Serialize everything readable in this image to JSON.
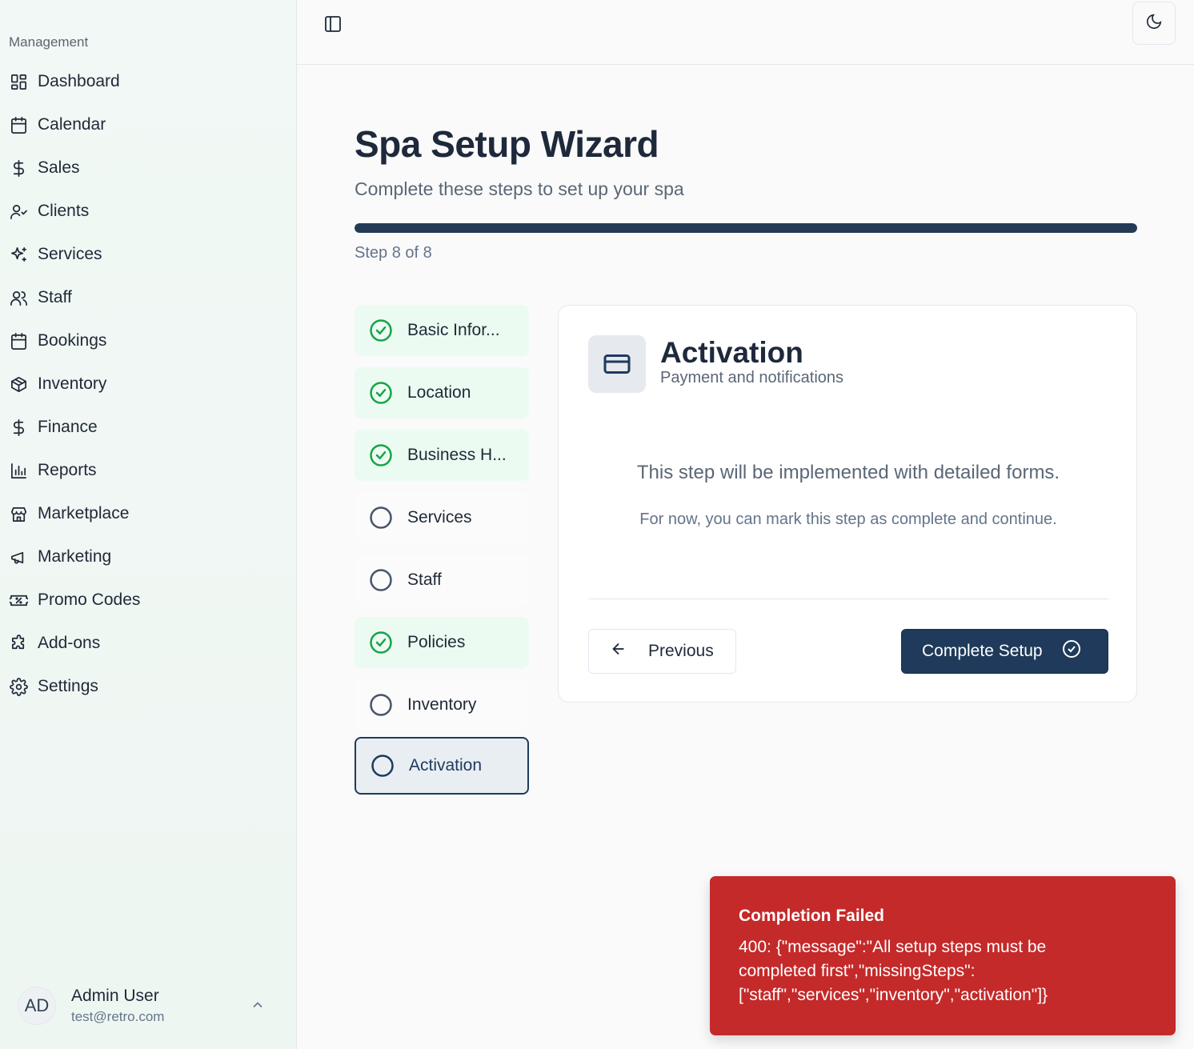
{
  "sidebar": {
    "group_label": "Management",
    "items": [
      {
        "label": "Dashboard",
        "icon": "dashboard-icon"
      },
      {
        "label": "Calendar",
        "icon": "calendar-icon"
      },
      {
        "label": "Sales",
        "icon": "dollar-icon"
      },
      {
        "label": "Clients",
        "icon": "user-check-icon"
      },
      {
        "label": "Services",
        "icon": "sparkles-icon"
      },
      {
        "label": "Staff",
        "icon": "users-icon"
      },
      {
        "label": "Bookings",
        "icon": "calendar-icon"
      },
      {
        "label": "Inventory",
        "icon": "package-icon"
      },
      {
        "label": "Finance",
        "icon": "dollar-icon"
      },
      {
        "label": "Reports",
        "icon": "bar-chart-icon"
      },
      {
        "label": "Marketplace",
        "icon": "store-icon"
      },
      {
        "label": "Marketing",
        "icon": "megaphone-icon"
      },
      {
        "label": "Promo Codes",
        "icon": "ticket-percent-icon"
      },
      {
        "label": "Add-ons",
        "icon": "puzzle-icon"
      },
      {
        "label": "Settings",
        "icon": "gear-icon"
      }
    ],
    "user": {
      "initials": "AD",
      "name": "Admin User",
      "email": "test@retro.com"
    }
  },
  "header": {
    "panel_toggle_icon": "panel-left-icon",
    "theme_icon": "moon-icon"
  },
  "wizard": {
    "title": "Spa Setup Wizard",
    "subtitle": "Complete these steps to set up your spa",
    "progress": 1.0,
    "step_count": "Step 8 of 8",
    "steps": [
      {
        "label": "Basic Infor...",
        "done": true
      },
      {
        "label": "Location",
        "done": true
      },
      {
        "label": "Business H...",
        "done": true
      },
      {
        "label": "Services",
        "done": false
      },
      {
        "label": "Staff",
        "done": false
      },
      {
        "label": "Policies",
        "done": true
      },
      {
        "label": "Inventory",
        "done": false
      },
      {
        "label": "Activation",
        "done": false,
        "active": true
      }
    ],
    "card": {
      "icon": "credit-card-icon",
      "title": "Activation",
      "subtitle": "Payment and notifications",
      "message": "This step will be implemented with detailed forms.",
      "note": "For now, you can mark this step as complete and continue.",
      "prev_label": "Previous",
      "complete_label": "Complete Setup"
    }
  },
  "toast": {
    "title": "Completion Failed",
    "message": "400: {\"message\":\"All setup steps must be completed first\",\"missingSteps\":[\"staff\",\"services\",\"inventory\",\"activation\"]}",
    "color": "#c42a2a"
  },
  "colors": {
    "primary": "#1f3a5a",
    "success": "#16a34a"
  }
}
